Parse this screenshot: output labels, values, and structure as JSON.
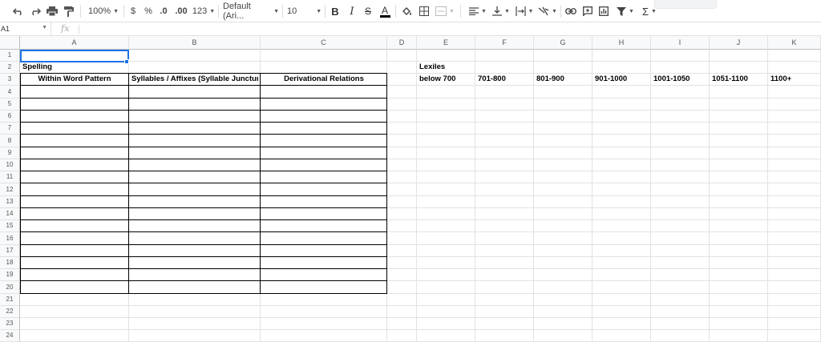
{
  "toolbar": {
    "zoom": "100%",
    "currency": "$",
    "percent": "%",
    "decrease_decimal": ".0",
    "increase_decimal": ".00",
    "number_format": "123",
    "font": "Default (Ari...",
    "font_size": "10",
    "bold": "B",
    "italic": "I",
    "strike": "S",
    "text_color": "A",
    "functions": "Σ"
  },
  "formula_bar": {
    "name_box": "A1",
    "fx": "fx",
    "value": ""
  },
  "columns": [
    "A",
    "B",
    "C",
    "D",
    "E",
    "F",
    "G",
    "H",
    "I",
    "J",
    "K"
  ],
  "rows": [
    "1",
    "2",
    "3",
    "4",
    "5",
    "6",
    "7",
    "8",
    "9",
    "10",
    "11",
    "12",
    "13",
    "14",
    "15",
    "16",
    "17",
    "18",
    "19",
    "20",
    "21",
    "22",
    "23",
    "24"
  ],
  "cells": {
    "A2": "Spelling",
    "A3": "Within Word Pattern",
    "B3": "Syllables / Affixes (Syllable Juncture)",
    "C3": "Derivational Relations",
    "E2": "Lexiles",
    "E3": "below 700",
    "F3": "701-800",
    "G3": "801-900",
    "H3": "901-1000",
    "I3": "1001-1050",
    "J3": "1051-1100",
    "K3": "1100+"
  },
  "colors": {
    "selection": "#1a73e8",
    "header_bg": "#f8f9fa",
    "gridline": "#e2e2e2"
  }
}
